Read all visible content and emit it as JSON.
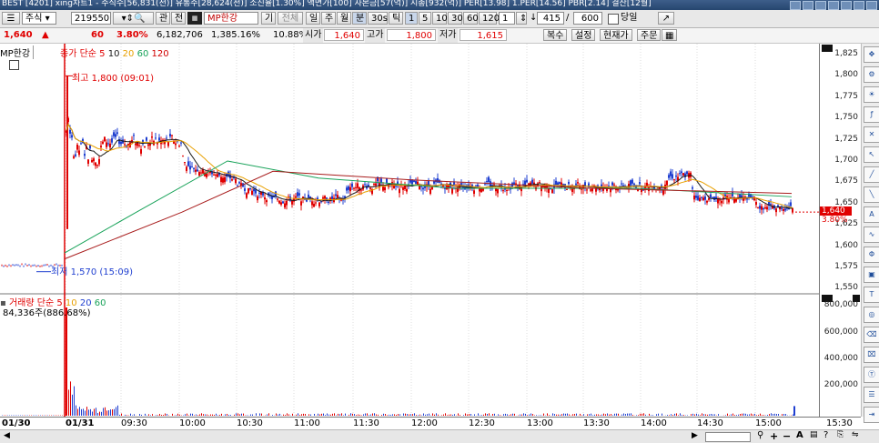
{
  "window": {
    "title": "BEST  [4201] xing차트1 - 주식수[56,831(천)] 유통주[28,624(천)] 소진율[1.30%] 액면가[100] 자본금[57(억)] 시총[932(억)] PER[13.98] 1.PER[14.56] PBR[2.14] 결산[12월]"
  },
  "toolbar": {
    "stock_type": "주식",
    "code": "219550",
    "gwan": "관",
    "jeon": "전",
    "stock_name": "MP한강",
    "gi": "기",
    "jeonche": "전체",
    "periods": [
      "일",
      "주",
      "월",
      "분",
      "30s",
      "틱"
    ],
    "active_period": "분",
    "intervals": [
      "1",
      "5",
      "10",
      "30",
      "60",
      "120"
    ],
    "unit_value": "1",
    "count_value": "415",
    "total_value": "600",
    "dangil": "당일"
  },
  "quote": {
    "price": "1,640",
    "arrow": "▲",
    "change": "60",
    "change_pct": "3.80%",
    "volume": "6,182,706",
    "volume_pct": "1,385.16%",
    "turnover": "10.88%",
    "open_label": "시가",
    "open": "1,640",
    "high_label": "고가",
    "high": "1,800",
    "low_label": "저가",
    "low": "1,615",
    "buttons": [
      "복수",
      "설정",
      "현재가",
      "주문"
    ]
  },
  "price_panel": {
    "stock_label": "MP한강",
    "legend_title": "종가 단순",
    "ma": [
      {
        "label": "5",
        "color": "#e00000"
      },
      {
        "label": "10",
        "color": "#1a1a1a"
      },
      {
        "label": "20",
        "color": "#e8a000"
      },
      {
        "label": "60",
        "color": "#19a35a"
      },
      {
        "label": "120",
        "color": "#d10000"
      }
    ],
    "high_note": "최고 1,800 (09:01)",
    "low_note": "최저 1,570 (15:09)",
    "current_tag": "1,640",
    "current_pct": "3.80%",
    "y_labels": [
      "1,825",
      "1,800",
      "1,775",
      "1,750",
      "1,725",
      "1,700",
      "1,675",
      "1,650",
      "1,625",
      "1,600",
      "1,575",
      "1,550"
    ]
  },
  "volume_panel": {
    "legend_title": "거래량 단순",
    "ma": [
      {
        "label": "5",
        "color": "#e00000"
      },
      {
        "label": "10",
        "color": "#e8a000"
      },
      {
        "label": "20",
        "color": "#1f3fd0"
      },
      {
        "label": "60",
        "color": "#19a35a"
      }
    ],
    "value_note": "84,336주(886.68%)",
    "y_labels": [
      "800,000",
      "600,000",
      "400,000",
      "200,000"
    ]
  },
  "x_labels": [
    "01/30",
    "01/31",
    "09:30",
    "10:00",
    "10:30",
    "11:00",
    "11:30",
    "12:00",
    "12:30",
    "13:00",
    "13:30",
    "14:00",
    "14:30",
    "15:00",
    "15:30"
  ],
  "colors": {
    "up": "#e00000",
    "down": "#1f3fd0",
    "accent": "#26466f"
  }
}
